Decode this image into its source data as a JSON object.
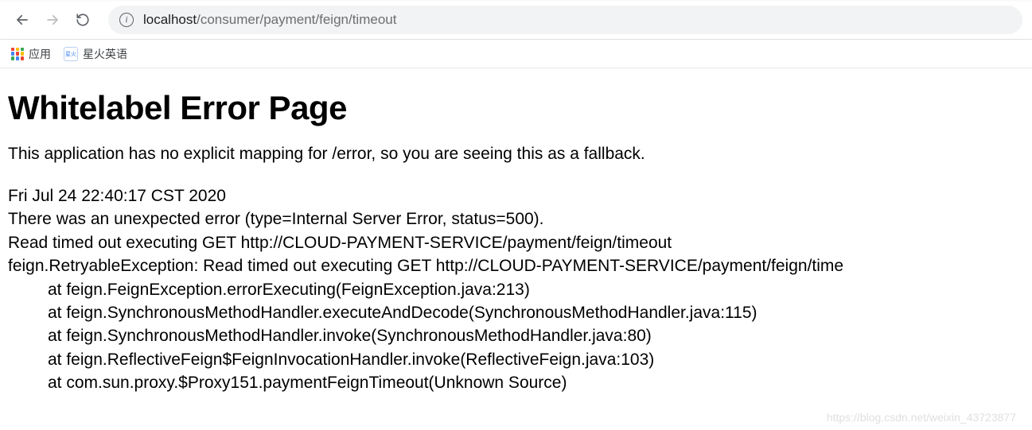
{
  "browser": {
    "url_host": "localhost",
    "url_path": "/consumer/payment/feign/timeout",
    "info_glyph": "i"
  },
  "bookmarks": {
    "apps_label": "应用",
    "spark_favicon_text": "星火",
    "spark_label": "星火英语"
  },
  "error": {
    "title": "Whitelabel Error Page",
    "subtitle": "This application has no explicit mapping for /error, so you are seeing this as a fallback.",
    "timestamp": "Fri Jul 24 22:40:17 CST 2020",
    "summary": "There was an unexpected error (type=Internal Server Error, status=500).",
    "message": "Read timed out executing GET http://CLOUD-PAYMENT-SERVICE/payment/feign/timeout",
    "exception": "feign.RetryableException: Read timed out executing GET http://CLOUD-PAYMENT-SERVICE/payment/feign/time",
    "stack": [
      "at feign.FeignException.errorExecuting(FeignException.java:213)",
      "at feign.SynchronousMethodHandler.executeAndDecode(SynchronousMethodHandler.java:115)",
      "at feign.SynchronousMethodHandler.invoke(SynchronousMethodHandler.java:80)",
      "at feign.ReflectiveFeign$FeignInvocationHandler.invoke(ReflectiveFeign.java:103)",
      "at com.sun.proxy.$Proxy151.paymentFeignTimeout(Unknown Source)"
    ]
  },
  "watermark": "https://blog.csdn.net/weixin_43723877"
}
